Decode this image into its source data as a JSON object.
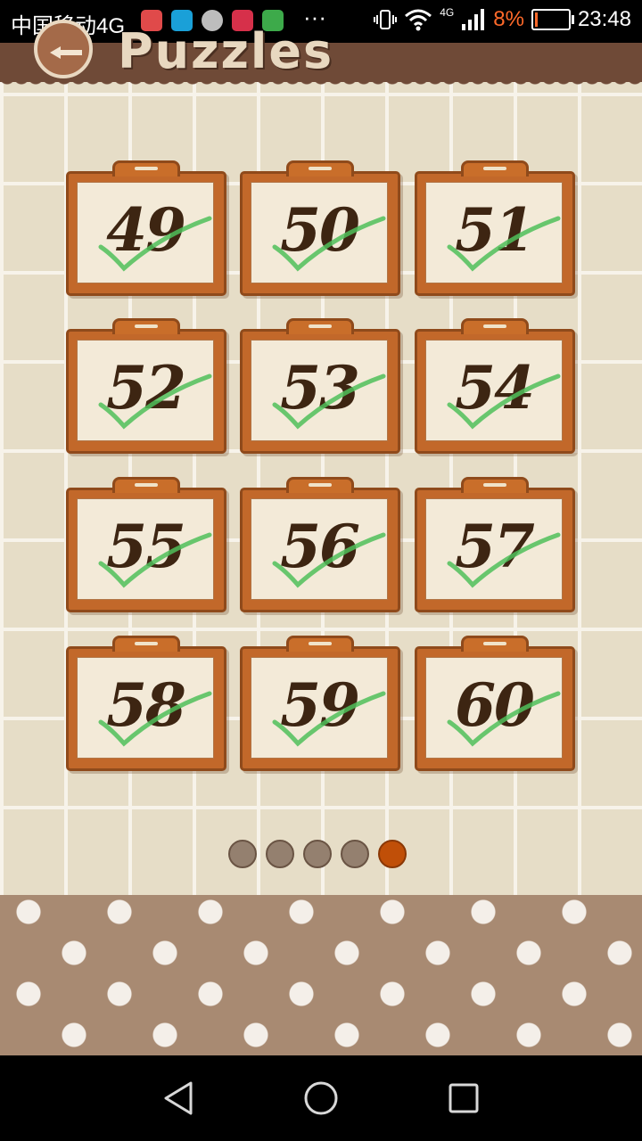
{
  "status_bar": {
    "carrier": "中国移动4G",
    "network_type": "4G",
    "battery_percent": "8%",
    "battery_level": 0.08,
    "time": "23:48",
    "more_glyph": "···",
    "notification_icons": [
      "clipboard-icon",
      "tap-icon",
      "moon-icon",
      "huawei-icon",
      "grid-app-icon"
    ]
  },
  "header": {
    "title": "Puzzles",
    "back_icon": "back-arrow-icon"
  },
  "levels": [
    {
      "number": "49",
      "completed": true
    },
    {
      "number": "50",
      "completed": true
    },
    {
      "number": "51",
      "completed": true
    },
    {
      "number": "52",
      "completed": true
    },
    {
      "number": "53",
      "completed": true
    },
    {
      "number": "54",
      "completed": true
    },
    {
      "number": "55",
      "completed": true
    },
    {
      "number": "56",
      "completed": true
    },
    {
      "number": "57",
      "completed": true
    },
    {
      "number": "58",
      "completed": true
    },
    {
      "number": "59",
      "completed": true
    },
    {
      "number": "60",
      "completed": true
    }
  ],
  "pagination": {
    "pages": 5,
    "current": 5
  },
  "colors": {
    "header_brown": "#6f4a37",
    "card_orange": "#c2682a",
    "check_green": "#4fc05a",
    "active_dot": "#c04f08",
    "inactive_dot": "#94806f"
  },
  "navbar": {
    "icons": [
      "back-triangle-icon",
      "home-circle-icon",
      "recents-square-icon"
    ]
  }
}
